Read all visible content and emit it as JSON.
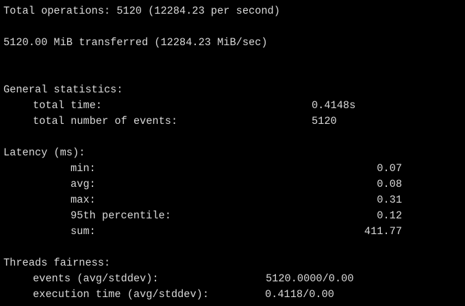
{
  "summary": {
    "operations": "Total operations: 5120 (12284.23 per second)",
    "transferred": "5120.00 MiB transferred (12284.23 MiB/sec)"
  },
  "general": {
    "heading": "General statistics:",
    "rows": [
      {
        "label": "total time:",
        "value": "0.4148s"
      },
      {
        "label": "total number of events:",
        "value": "5120"
      }
    ]
  },
  "latency": {
    "heading": "Latency (ms):",
    "rows": [
      {
        "label": "min:",
        "value": "0.07"
      },
      {
        "label": "avg:",
        "value": "0.08"
      },
      {
        "label": "max:",
        "value": "0.31"
      },
      {
        "label": "95th percentile:",
        "value": "0.12"
      },
      {
        "label": "sum:",
        "value": "411.77"
      }
    ]
  },
  "fairness": {
    "heading": "Threads fairness:",
    "rows": [
      {
        "label": "events (avg/stddev):",
        "value": "5120.0000/0.00"
      },
      {
        "label": "execution time (avg/stddev):",
        "value": "0.4118/0.00"
      }
    ]
  },
  "colors": {
    "background": "#000000",
    "text": "#d9d9d9"
  }
}
